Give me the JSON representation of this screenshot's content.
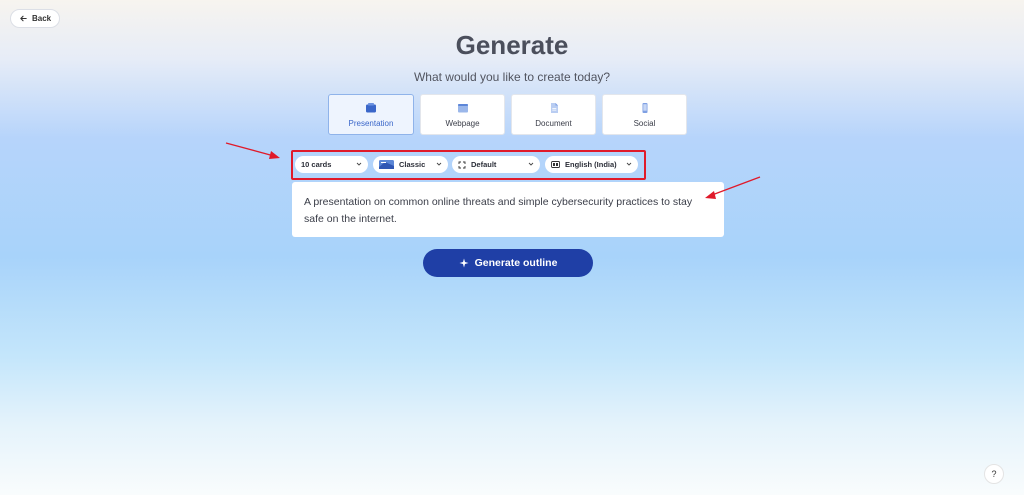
{
  "back_label": "Back",
  "title": "Generate",
  "subtitle": "What would you like to create today?",
  "types": [
    {
      "label": "Presentation",
      "icon": "presentation-icon",
      "selected": true
    },
    {
      "label": "Webpage",
      "icon": "webpage-icon",
      "selected": false
    },
    {
      "label": "Document",
      "icon": "document-icon",
      "selected": false
    },
    {
      "label": "Social",
      "icon": "social-icon",
      "selected": false
    }
  ],
  "options": {
    "cards": "10 cards",
    "theme": "Classic",
    "size": "Default",
    "language": "English (India)"
  },
  "prompt": "A presentation on common online threats and simple cybersecurity practices to stay safe on the internet.",
  "generate_label": "Generate outline",
  "help_label": "?",
  "colors": {
    "accent": "#1f3fa6",
    "highlight_box": "#e01a2a",
    "annotation_arrow": "#e01a2a"
  }
}
